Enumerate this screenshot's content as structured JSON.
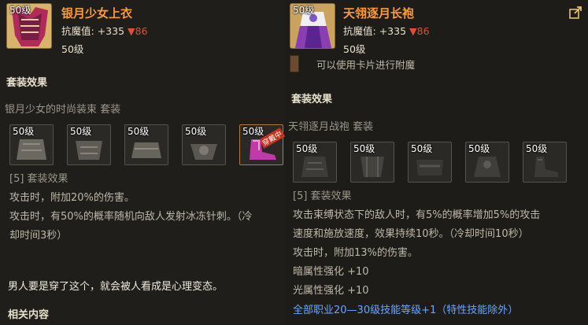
{
  "left": {
    "level_badge": "50级",
    "name": "银月少女上衣",
    "resist_label": "抗魔值:",
    "resist_plus": "+335",
    "resist_minus": "▼86",
    "req_level": "50级",
    "set_effects_title": "套装效果",
    "set_name": "银月少女的时尚装束 套装",
    "pieces": [
      {
        "level": "50级"
      },
      {
        "level": "50级"
      },
      {
        "level": "50级"
      },
      {
        "level": "50级"
      },
      {
        "level": "50级",
        "tag": "穿戴中"
      }
    ],
    "effect_head": "[5] 套装效果",
    "effects": [
      "攻击时，附加20%的伤害。",
      "攻击时，有50%的概率随机向敌人发射冰冻针刺。（冷",
      "却时间3秒）"
    ],
    "flavor": "男人要是穿了这个，就会被人看成是心理变态。",
    "related": "相关内容"
  },
  "right": {
    "level_badge": "50级",
    "name": "天翎逐月长袍",
    "resist_label": "抗魔值:",
    "resist_plus": "+335",
    "resist_minus": "▼86",
    "req_level": "50级",
    "card_text": "可以使用卡片进行附魔",
    "set_effects_title": "套装效果",
    "set_name": "天翎逐月战袍  套装",
    "pieces": [
      {
        "level": "50级"
      },
      {
        "level": "50级"
      },
      {
        "level": "50级"
      },
      {
        "level": "50级"
      },
      {
        "level": "50级"
      }
    ],
    "effect_head": "[5] 套装效果",
    "effects": [
      "攻击束缚状态下的敌人时，有5%的概率增加5%的攻击",
      "速度和施放速度，效果持续10秒。（冷却时间10秒）",
      "攻击时，附加13%的伤害。",
      "暗属性强化 +10",
      "光属性强化 +10"
    ],
    "skill_line": "全部职业20—30级技能等级+1（特性技能除外）"
  },
  "colors": {
    "name": "#ff9a34",
    "negative": "#e84a3a",
    "skill": "#6aa6ff",
    "text": "#bfb8a8"
  },
  "icons": [
    "share-icon",
    "top-garment-icon",
    "robe-icon",
    "shoe-icon",
    "card-slot-icon"
  ]
}
